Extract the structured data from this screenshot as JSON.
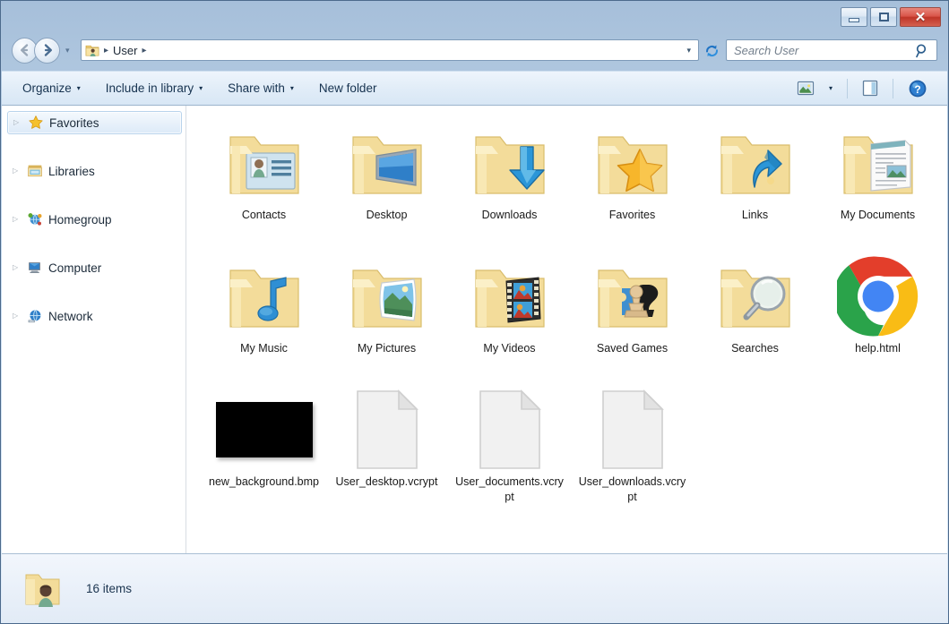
{
  "window": {
    "controls": {
      "minimize": "Minimize",
      "maximize": "Maximize",
      "close": "✕"
    }
  },
  "navigation": {
    "back_label": "Back",
    "forward_label": "Forward",
    "recent_label": "Recent pages",
    "refresh_label": "Refresh"
  },
  "address": {
    "icon": "user-folder-icon",
    "separator": "▸",
    "crumb": "User",
    "dropdown": "▾"
  },
  "search": {
    "placeholder": "Search User",
    "icon": "search-icon"
  },
  "toolbar": {
    "organize": "Organize",
    "include_in_library": "Include in library",
    "share_with": "Share with",
    "new_folder": "New folder",
    "caret": "▾",
    "view_icon": "change-view-icon",
    "preview_icon": "preview-pane-icon",
    "help_icon": "help-icon"
  },
  "sidebar": {
    "items": [
      {
        "label": "Favorites",
        "icon": "star-icon",
        "selected": true
      },
      {
        "label": "Libraries",
        "icon": "libraries-icon",
        "selected": false
      },
      {
        "label": "Homegroup",
        "icon": "homegroup-icon",
        "selected": false
      },
      {
        "label": "Computer",
        "icon": "computer-icon",
        "selected": false
      },
      {
        "label": "Network",
        "icon": "network-icon",
        "selected": false
      }
    ],
    "expander": "▷"
  },
  "content": {
    "items": [
      {
        "label": "Contacts",
        "icon": "folder-contacts"
      },
      {
        "label": "Desktop",
        "icon": "folder-desktop"
      },
      {
        "label": "Downloads",
        "icon": "folder-downloads"
      },
      {
        "label": "Favorites",
        "icon": "folder-favorites"
      },
      {
        "label": "Links",
        "icon": "folder-links"
      },
      {
        "label": "My Documents",
        "icon": "folder-documents"
      },
      {
        "label": "My Music",
        "icon": "folder-music"
      },
      {
        "label": "My Pictures",
        "icon": "folder-pictures"
      },
      {
        "label": "My Videos",
        "icon": "folder-videos"
      },
      {
        "label": "Saved Games",
        "icon": "folder-savedgames"
      },
      {
        "label": "Searches",
        "icon": "folder-searches"
      },
      {
        "label": "help.html",
        "icon": "chrome-icon"
      },
      {
        "label": "new_background.bmp",
        "icon": "black-bitmap-thumbnail"
      },
      {
        "label": "User_desktop.vcrypt",
        "icon": "blank-document-icon"
      },
      {
        "label": "User_documents.vcrypt",
        "icon": "blank-document-icon"
      },
      {
        "label": "User_downloads.vcrypt",
        "icon": "blank-document-icon"
      }
    ]
  },
  "statusbar": {
    "icon": "user-folder-icon",
    "item_count": "16 items"
  },
  "colors": {
    "titlebar_top": "#a6bfda",
    "titlebar_bottom": "#dfebf8",
    "close_button": "#bf3528",
    "folder_yellow": "#f7dd8e",
    "selection_blue": "#ddeaf8",
    "chrome_red": "#e33e2b",
    "chrome_yellow": "#f9bc15",
    "chrome_green": "#2aa34a",
    "chrome_blue": "#4285f4"
  }
}
